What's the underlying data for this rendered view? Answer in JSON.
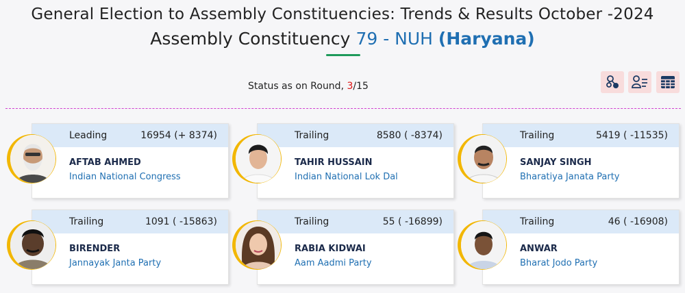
{
  "header": {
    "title_line1": "General Election to Assembly Constituencies: Trends & Results October -2024",
    "ac_prefix": "Assembly Constituency",
    "ac_number_name": "79 - NUH",
    "ac_state": "(Haryana)"
  },
  "status": {
    "label": "Status as on Round, ",
    "current_round": "3",
    "total_rounds": "/15"
  },
  "toolbar": {
    "icons": [
      "network-icon",
      "user-list-icon",
      "table-grid-icon"
    ],
    "accent_color": "#f8dcdc"
  },
  "colors": {
    "status_bar": "#dbe9f8",
    "party_text": "#1f6fb2",
    "avatar_ring": "#f2b705",
    "divider": "#d03fd0",
    "underline": "#1e9a5a"
  },
  "candidates": [
    {
      "status": "Leading",
      "votes": "16954 (+ 8374)",
      "name": "AFTAB AHMED",
      "party": "Indian National Congress"
    },
    {
      "status": "Trailing",
      "votes": "8580 ( -8374)",
      "name": "TAHIR HUSSAIN",
      "party": "Indian National Lok Dal"
    },
    {
      "status": "Trailing",
      "votes": "5419 ( -11535)",
      "name": "SANJAY SINGH",
      "party": "Bharatiya Janata Party"
    },
    {
      "status": "Trailing",
      "votes": "1091 ( -15863)",
      "name": "BIRENDER",
      "party": "Jannayak Janta Party"
    },
    {
      "status": "Trailing",
      "votes": "55 ( -16899)",
      "name": "RABIA KIDWAI",
      "party": "Aam Aadmi Party"
    },
    {
      "status": "Trailing",
      "votes": "46 ( -16908)",
      "name": "ANWAR",
      "party": "Bharat Jodo Party"
    }
  ]
}
